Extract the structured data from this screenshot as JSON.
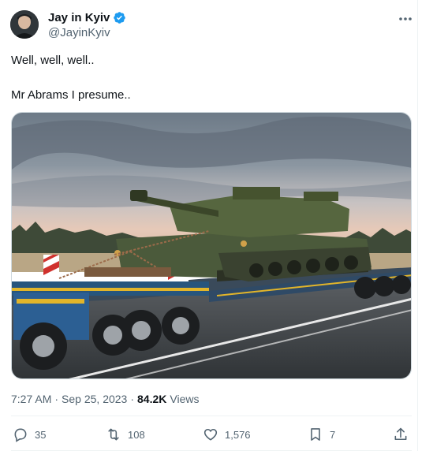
{
  "author": {
    "name": "Jay in Kyiv",
    "handle": "@JayinKyiv",
    "verified": true,
    "verified_color": "#1d9bf0"
  },
  "menu": {
    "icon": "more-horizontal-icon"
  },
  "tweet": {
    "line1": "Well, well, well..",
    "line2": "Mr Abrams I presume..",
    "media_description": "M1 Abrams tank on a low-loader trailer truck on a road at dusk"
  },
  "meta": {
    "time": "7:27 AM",
    "separator": "·",
    "date": "Sep 25, 2023",
    "views_count": "84.2K",
    "views_label": "Views"
  },
  "actions": {
    "replies": "35",
    "reposts": "108",
    "likes": "1,576",
    "bookmarks": "7"
  },
  "colors": {
    "text": "#0f1419",
    "secondary": "#536471",
    "border": "#eff3f4"
  }
}
